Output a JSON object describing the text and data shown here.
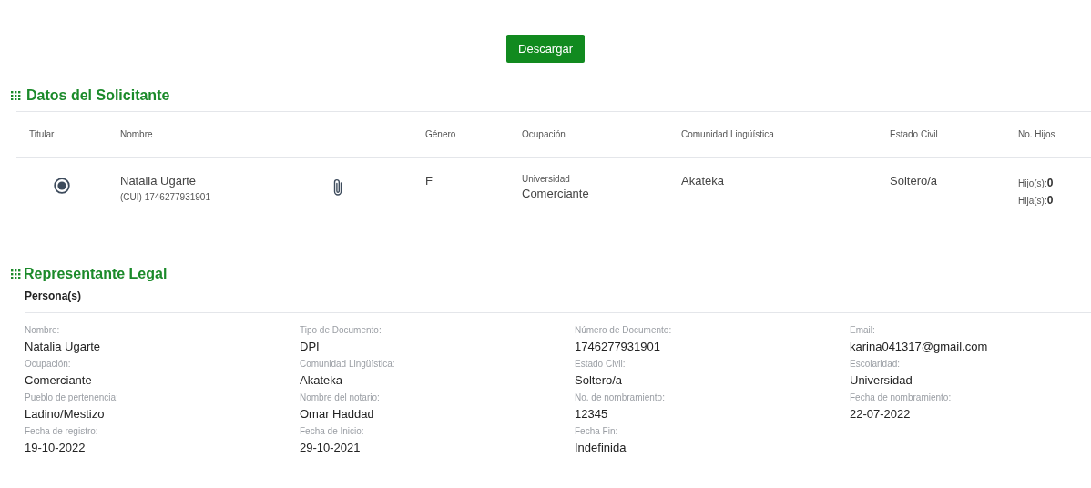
{
  "download_button": {
    "label": "Descargar"
  },
  "applicant": {
    "title": "Datos del Solicitante",
    "columns": [
      "Titular",
      "Nombre",
      "Género",
      "Ocupación",
      "Comunidad Lingüística",
      "Estado Civil",
      "No. Hijos"
    ],
    "rows": [
      {
        "selected": true,
        "name": "Natalia Ugarte",
        "document": "(CUI) 1746277931901",
        "gender": "F",
        "education": "Universidad",
        "occupation": "Comerciante",
        "community": "Akateka",
        "civil_status": "Soltero/a",
        "children": [
          {
            "label": "Hijo(s):",
            "value": "0"
          },
          {
            "label": "Hija(s):",
            "value": "0"
          }
        ]
      }
    ]
  },
  "legal_rep": {
    "title": "Representante Legal",
    "subtitle": "Persona(s)",
    "fields": [
      {
        "label": "Nombre:",
        "value": "Natalia Ugarte"
      },
      {
        "label": "Tipo de Documento:",
        "value": "DPI"
      },
      {
        "label": "Número de Documento:",
        "value": "1746277931901"
      },
      {
        "label": "Email:",
        "value": "karina041317@gmail.com"
      },
      {
        "label": "Ocupación:",
        "value": "Comerciante"
      },
      {
        "label": "Comunidad Lingüística:",
        "value": "Akateka"
      },
      {
        "label": "Estado Civil:",
        "value": "Soltero/a"
      },
      {
        "label": "Escolaridad:",
        "value": "Universidad"
      },
      {
        "label": "Pueblo de pertenencia:",
        "value": "Ladino/Mestizo"
      },
      {
        "label": "Nombre del notario:",
        "value": "Omar Haddad"
      },
      {
        "label": "No. de nombramiento:",
        "value": "12345"
      },
      {
        "label": "Fecha de nombramiento:",
        "value": "22-07-2022"
      },
      {
        "label": "Fecha de registro:",
        "value": "19-10-2022"
      },
      {
        "label": "Fecha de Inicio:",
        "value": "29-10-2021"
      },
      {
        "label": "Fecha Fin:",
        "value": "Indefinida"
      }
    ]
  }
}
